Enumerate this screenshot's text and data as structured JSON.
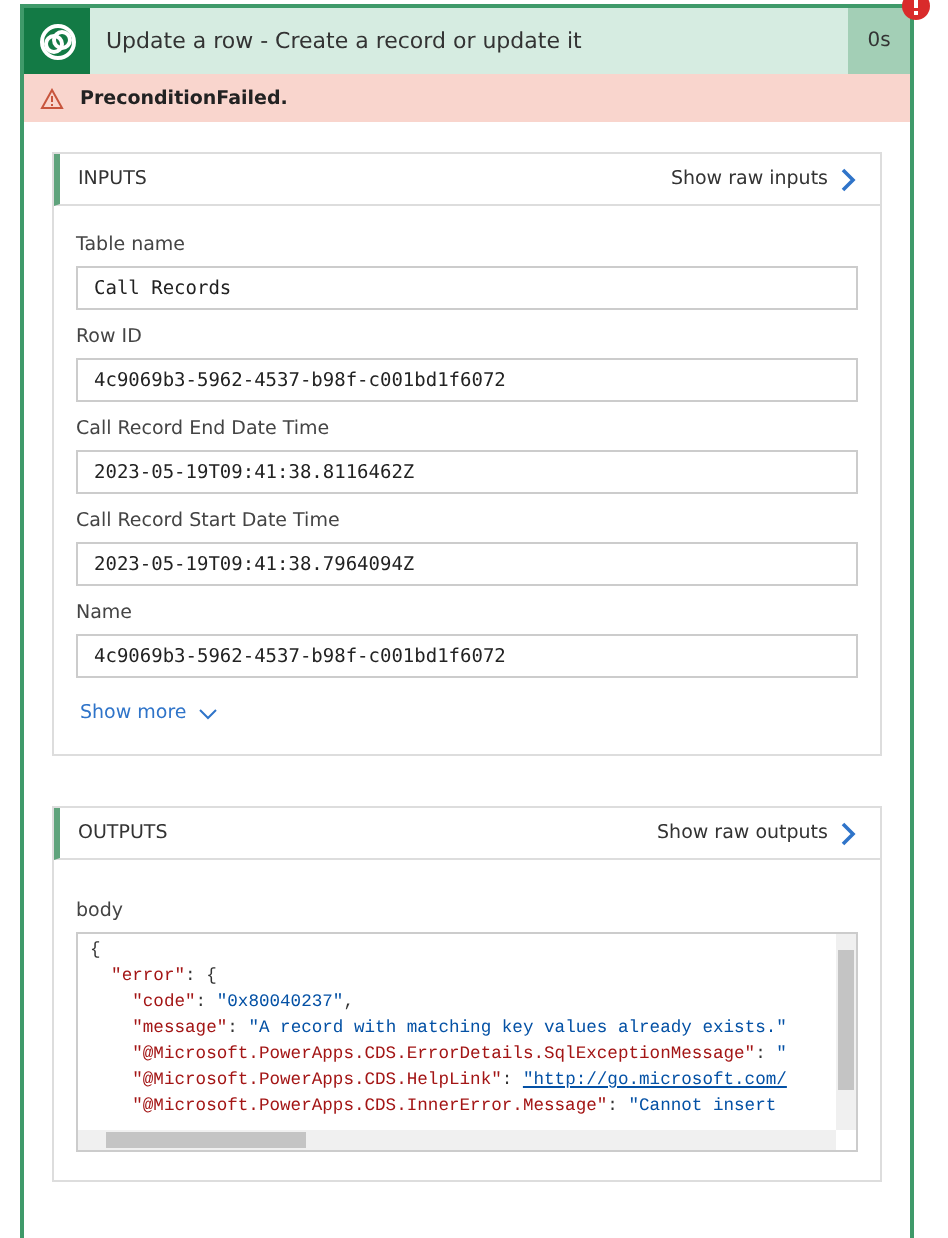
{
  "header": {
    "title": "Update a row - Create a record or update it",
    "duration": "0s",
    "failed": true
  },
  "error_bar": {
    "message": "PreconditionFailed."
  },
  "inputs": {
    "title": "INPUTS",
    "raw_link": "Show raw inputs",
    "fields": [
      {
        "label": "Table name",
        "value": "Call Records"
      },
      {
        "label": "Row ID",
        "value": "4c9069b3-5962-4537-b98f-c001bd1f6072"
      },
      {
        "label": "Call Record End Date Time",
        "value": "2023-05-19T09:41:38.8116462Z"
      },
      {
        "label": "Call Record Start Date Time",
        "value": "2023-05-19T09:41:38.7964094Z"
      },
      {
        "label": "Name",
        "value": "4c9069b3-5962-4537-b98f-c001bd1f6072"
      }
    ],
    "show_more": "Show more"
  },
  "outputs": {
    "title": "OUTPUTS",
    "raw_link": "Show raw outputs",
    "body_label": "body",
    "code_lines": [
      [
        {
          "kind": "punct",
          "text": "{"
        }
      ],
      [
        {
          "kind": "key",
          "text": "  \"error\""
        },
        {
          "kind": "punct",
          "text": ": {"
        }
      ],
      [
        {
          "kind": "key",
          "text": "    \"code\""
        },
        {
          "kind": "punct",
          "text": ": "
        },
        {
          "kind": "string",
          "text": "\"0x80040237\""
        },
        {
          "kind": "punct",
          "text": ","
        }
      ],
      [
        {
          "kind": "key",
          "text": "    \"message\""
        },
        {
          "kind": "punct",
          "text": ": "
        },
        {
          "kind": "string",
          "text": "\"A record with matching key values already exists.\""
        }
      ],
      [
        {
          "kind": "key",
          "text": "    \"@Microsoft.PowerApps.CDS.ErrorDetails.SqlExceptionMessage\""
        },
        {
          "kind": "punct",
          "text": ": "
        },
        {
          "kind": "string",
          "text": "\""
        }
      ],
      [
        {
          "kind": "key",
          "text": "    \"@Microsoft.PowerApps.CDS.HelpLink\""
        },
        {
          "kind": "punct",
          "text": ": "
        },
        {
          "kind": "link",
          "text": "\"http://go.microsoft.com/"
        }
      ],
      [
        {
          "kind": "key",
          "text": "    \"@Microsoft.PowerApps.CDS.InnerError.Message\""
        },
        {
          "kind": "punct",
          "text": ": "
        },
        {
          "kind": "string",
          "text": "\"Cannot insert"
        }
      ]
    ]
  }
}
